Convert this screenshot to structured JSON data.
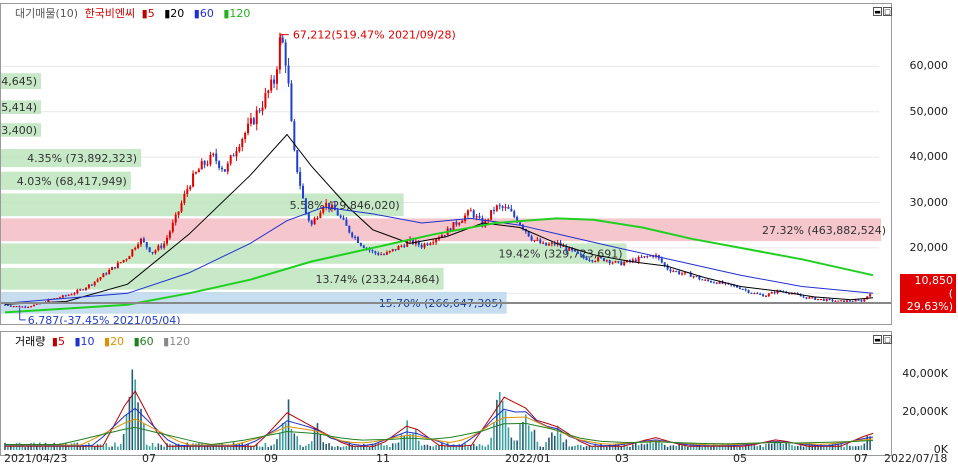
{
  "colors": {
    "up": "#e00000",
    "down": "#1f3fd0",
    "ma5": "#c00000",
    "ma20": "#000000",
    "ma60": "#2030d0",
    "ma120": "#20d020",
    "vp_green": "#b9e3b9",
    "vp_red": "#f2b8bf",
    "vp_blue": "#b9d6ec"
  },
  "corner_tab": "호",
  "price_legend": {
    "main": "대기매물(10)",
    "name": "한국비엔씨",
    "ma": [
      "5",
      "20",
      "60",
      "120"
    ]
  },
  "volume_legend": {
    "name": "거래량",
    "ma": [
      "5",
      "10",
      "20",
      "60",
      "120"
    ]
  },
  "high_annotation": "67,212(519.47% 2021/09/28)",
  "low_annotation": "6,787(-37.45% 2021/05/04)",
  "current_price": "10,850",
  "current_change": "( 29.63%)",
  "price_axis_labels": [
    "60,000",
    "50,000",
    "40,000",
    "30,000",
    "20,000",
    "10,000"
  ],
  "volume_axis_labels": [
    "40,000K",
    "20,000K",
    "0K"
  ],
  "x_labels": [
    "2021/04/23",
    "07",
    "09",
    "11",
    "2022/01",
    "03",
    "05",
    "07",
    "2022/07/18"
  ],
  "chart_data": {
    "type": "candlestick",
    "title": "한국비엔씨",
    "x_start": "2021/04/23",
    "x_end": "2022/07/18",
    "ylim": [
      5000,
      70000
    ],
    "volume_ylim": [
      0,
      55000
    ],
    "volume_unit": "K",
    "high": {
      "value": 67212,
      "change": "519.47%",
      "date": "2021/09/28"
    },
    "low": {
      "value": 6787,
      "change": "-37.45%",
      "date": "2021/05/04"
    },
    "last": {
      "value": 10850,
      "change": "29.63%",
      "date": "2022/07/18"
    },
    "price_path": [
      [
        0,
        7500
      ],
      [
        0.12,
        7000
      ],
      [
        0.2,
        7200
      ],
      [
        0.3,
        7800
      ],
      [
        0.35,
        8500
      ],
      [
        0.4,
        8800
      ],
      [
        0.5,
        9500
      ],
      [
        0.6,
        10500
      ],
      [
        0.7,
        12000
      ],
      [
        0.8,
        14000
      ],
      [
        1.0,
        18000
      ],
      [
        1.1,
        22000
      ],
      [
        1.2,
        19000
      ],
      [
        1.3,
        21000
      ],
      [
        1.4,
        27000
      ],
      [
        1.5,
        34000
      ],
      [
        1.6,
        38000
      ],
      [
        1.7,
        40000
      ],
      [
        1.8,
        37000
      ],
      [
        1.9,
        43000
      ],
      [
        2.0,
        47000
      ],
      [
        2.1,
        52000
      ],
      [
        2.2,
        57000
      ],
      [
        2.25,
        67000
      ],
      [
        2.3,
        60000
      ],
      [
        2.35,
        42000
      ],
      [
        2.4,
        35000
      ],
      [
        2.45,
        28000
      ],
      [
        2.5,
        25000
      ],
      [
        2.6,
        30000
      ],
      [
        2.7,
        28000
      ],
      [
        2.8,
        24000
      ],
      [
        2.9,
        21000
      ],
      [
        3.0,
        19000
      ],
      [
        3.1,
        18500
      ],
      [
        3.2,
        20000
      ],
      [
        3.3,
        21500
      ],
      [
        3.4,
        20500
      ],
      [
        3.5,
        22000
      ],
      [
        3.6,
        23500
      ],
      [
        3.7,
        26000
      ],
      [
        3.8,
        28000
      ],
      [
        3.9,
        25000
      ],
      [
        4.0,
        29000
      ],
      [
        4.1,
        28500
      ],
      [
        4.2,
        25500
      ],
      [
        4.3,
        22000
      ],
      [
        4.4,
        20500
      ],
      [
        4.5,
        21000
      ],
      [
        4.6,
        19500
      ],
      [
        4.7,
        18000
      ],
      [
        4.8,
        17500
      ],
      [
        4.9,
        17500
      ],
      [
        5.0,
        16500
      ],
      [
        5.1,
        17000
      ],
      [
        5.2,
        17800
      ],
      [
        5.3,
        18500
      ],
      [
        5.4,
        15500
      ],
      [
        5.5,
        14500
      ],
      [
        5.6,
        14000
      ],
      [
        5.7,
        12800
      ],
      [
        5.8,
        12500
      ],
      [
        5.9,
        11800
      ],
      [
        6.0,
        11200
      ],
      [
        6.1,
        10000
      ],
      [
        6.2,
        9500
      ],
      [
        6.3,
        10500
      ],
      [
        6.4,
        10200
      ],
      [
        6.5,
        9200
      ],
      [
        6.6,
        8800
      ],
      [
        6.7,
        8500
      ],
      [
        6.8,
        8200
      ],
      [
        6.9,
        8300
      ],
      [
        7.0,
        8400
      ],
      [
        7.08,
        10850
      ]
    ],
    "ma20_path": [
      [
        0,
        7600
      ],
      [
        0.5,
        8200
      ],
      [
        1.0,
        12000
      ],
      [
        1.5,
        23000
      ],
      [
        2.0,
        36000
      ],
      [
        2.3,
        45000
      ],
      [
        2.5,
        38000
      ],
      [
        2.8,
        29000
      ],
      [
        3.0,
        24000
      ],
      [
        3.3,
        21000
      ],
      [
        3.6,
        22500
      ],
      [
        3.9,
        25500
      ],
      [
        4.2,
        24500
      ],
      [
        4.5,
        21000
      ],
      [
        4.8,
        18500
      ],
      [
        5.1,
        17000
      ],
      [
        5.4,
        16000
      ],
      [
        5.7,
        13500
      ],
      [
        6.0,
        11500
      ],
      [
        6.3,
        10500
      ],
      [
        6.6,
        9200
      ],
      [
        6.9,
        8600
      ],
      [
        7.08,
        9000
      ]
    ],
    "ma60_path": [
      [
        0,
        7800
      ],
      [
        1.0,
        10000
      ],
      [
        1.5,
        14500
      ],
      [
        2.0,
        21000
      ],
      [
        2.3,
        26000
      ],
      [
        2.6,
        29000
      ],
      [
        3.0,
        27500
      ],
      [
        3.4,
        25500
      ],
      [
        3.8,
        26500
      ],
      [
        4.2,
        25000
      ],
      [
        4.6,
        22500
      ],
      [
        5.0,
        20000
      ],
      [
        5.5,
        17000
      ],
      [
        6.0,
        14000
      ],
      [
        6.5,
        11500
      ],
      [
        7.08,
        10000
      ]
    ],
    "ma120_path": [
      [
        0,
        5800
      ],
      [
        1.0,
        7500
      ],
      [
        1.5,
        10000
      ],
      [
        2.0,
        13000
      ],
      [
        2.5,
        17000
      ],
      [
        3.0,
        20000
      ],
      [
        3.5,
        23000
      ],
      [
        4.0,
        25500
      ],
      [
        4.5,
        26500
      ],
      [
        4.8,
        26200
      ],
      [
        5.2,
        24500
      ],
      [
        5.6,
        22000
      ],
      [
        6.0,
        20000
      ],
      [
        6.5,
        17500
      ],
      [
        7.08,
        14000
      ]
    ],
    "volume_profile": [
      {
        "label": "0.87% (14,714,645)",
        "lo": 55000,
        "hi": 58500,
        "w": 0.87,
        "color": "green"
      },
      {
        "label": "0.40% (6,725,414)",
        "lo": 49500,
        "hi": 52500,
        "w": 0.4,
        "color": "green"
      },
      {
        "label": "0.65% (11,073,400)",
        "lo": 44500,
        "hi": 47500,
        "w": 0.65,
        "color": "green"
      },
      {
        "label": "4.35% (73,892,323)",
        "lo": 37800,
        "hi": 41800,
        "w": 4.35,
        "color": "green"
      },
      {
        "label": "4.03% (68,417,949)",
        "lo": 32800,
        "hi": 36800,
        "w": 4.03,
        "color": "green"
      },
      {
        "label": "5.58% (29,846,020)",
        "lo": 27000,
        "hi": 32000,
        "w": 12.5,
        "color": "green"
      },
      {
        "label": "27.32% (463,882,524)",
        "lo": 21500,
        "hi": 26500,
        "w": 27.32,
        "color": "red"
      },
      {
        "label": "19.42% (329,723,691)",
        "lo": 16500,
        "hi": 21000,
        "w": 19.42,
        "color": "green"
      },
      {
        "label": "13.74% (233,244,864)",
        "lo": 10800,
        "hi": 15600,
        "w": 13.74,
        "color": "green"
      },
      {
        "label": "15.70% (266,647,305)",
        "lo": 5500,
        "hi": 10300,
        "w": 15.7,
        "color": "blue"
      }
    ],
    "volume_spikes": [
      [
        1.05,
        52000
      ],
      [
        2.3,
        30000
      ],
      [
        2.55,
        15000
      ],
      [
        3.3,
        20000
      ],
      [
        4.05,
        40000
      ],
      [
        4.25,
        26000
      ],
      [
        4.5,
        18000
      ],
      [
        5.3,
        8000
      ],
      [
        6.3,
        6000
      ],
      [
        7.07,
        12000
      ]
    ]
  }
}
